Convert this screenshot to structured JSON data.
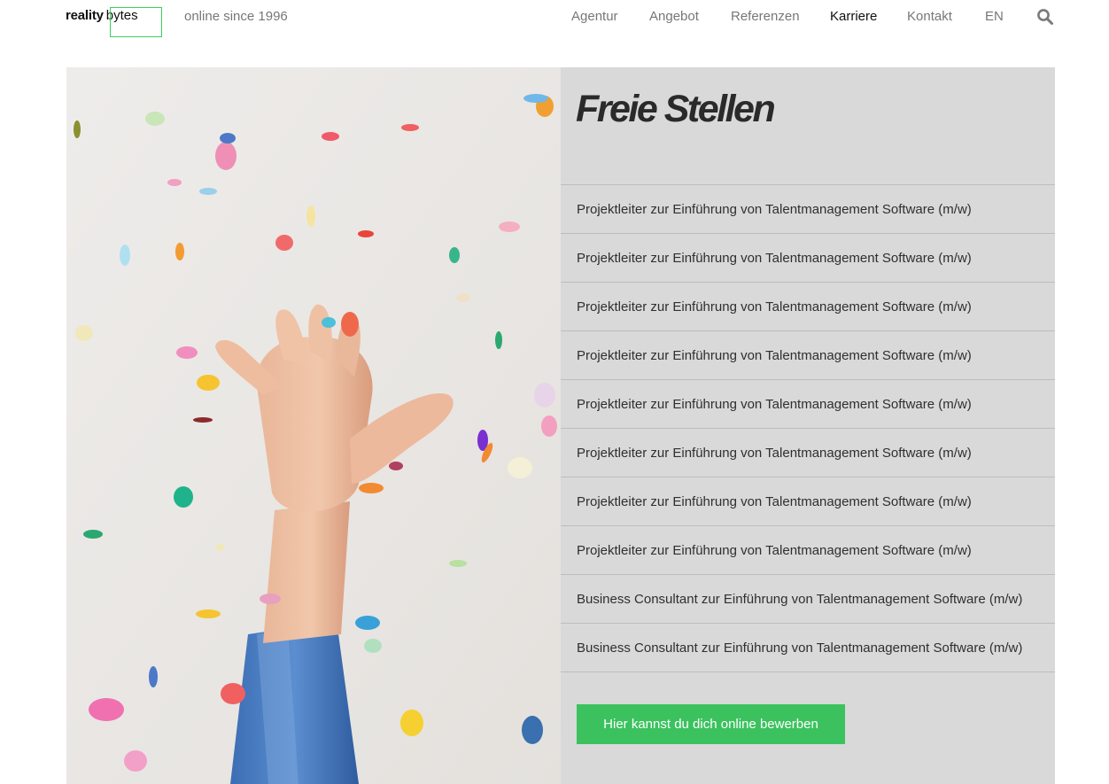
{
  "header": {
    "logo_part1": "reality",
    "logo_part2": "bytes",
    "tagline": "online since 1996",
    "nav": {
      "agentur": "Agentur",
      "angebot": "Angebot",
      "referenzen": "Referenzen",
      "karriere": "Karriere",
      "kontakt": "Kontakt",
      "language": "EN"
    },
    "active_nav": "Karriere",
    "search_icon": "search-icon"
  },
  "hero": {
    "image": "raised-hand-with-confetti"
  },
  "panel": {
    "title": "Freie Stellen",
    "jobs": [
      "Projektleiter zur Einführung von Talentmanagement Software (m/w)",
      "Projektleiter zur Einführung von Talentmanagement Software (m/w)",
      "Projektleiter zur Einführung von Talentmanagement Software (m/w)",
      "Projektleiter zur Einführung von Talentmanagement Software (m/w)",
      "Projektleiter zur Einführung von Talentmanagement Software (m/w)",
      "Projektleiter zur Einführung von Talentmanagement Software (m/w)",
      "Projektleiter zur Einführung von Talentmanagement Software (m/w)",
      "Projektleiter zur Einführung von Talentmanagement Software (m/w)",
      "Business Consultant zur Einführung von Talentmanagement Software (m/w)",
      "Business Consultant zur Einführung von Talentmanagement Software (m/w)"
    ],
    "apply_label": "Hier kannst du dich online bewerben"
  },
  "colors": {
    "panel_bg": "#d9d9d9",
    "accent_green": "#3bc25e",
    "nav_text": "#777777",
    "nav_active": "#111111"
  }
}
